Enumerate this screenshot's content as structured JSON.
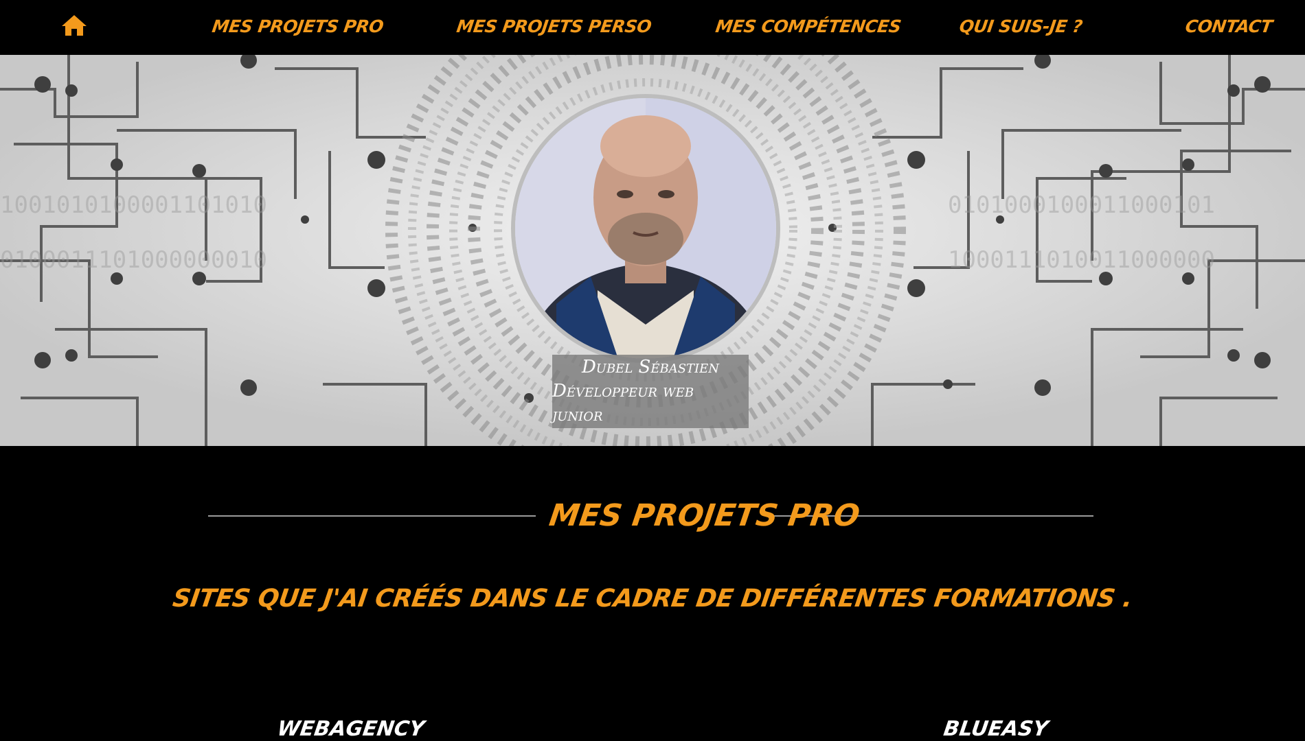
{
  "nav": {
    "home_icon": "home-icon",
    "items": [
      {
        "label": "Mes projets pro"
      },
      {
        "label": "Mes projets perso"
      },
      {
        "label": "Mes compétences"
      },
      {
        "label": "Qui suis-je ?"
      },
      {
        "label": "Contact"
      }
    ]
  },
  "hero": {
    "name": "Dubel Sébastien",
    "role": "Développeur web junior"
  },
  "section": {
    "title": "Mes projets pro",
    "subtitle": "Sites que j'ai créés dans le cadre de différentes formations .",
    "projects": [
      {
        "label": "WebAgency"
      },
      {
        "label": "BluEasy"
      }
    ]
  },
  "colors": {
    "accent": "#f39a1c",
    "background": "#000000",
    "hero_bg": "#cfcfcf"
  }
}
